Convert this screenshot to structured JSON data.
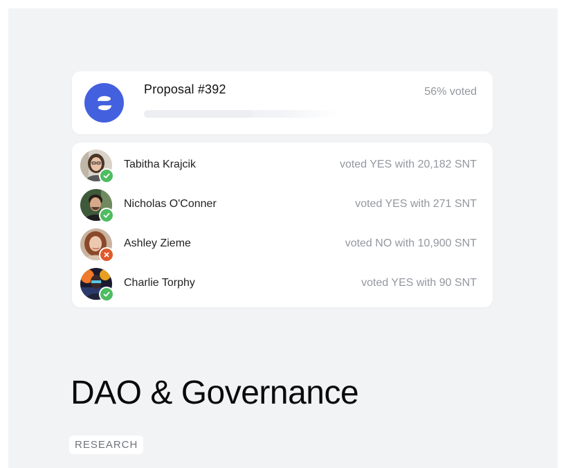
{
  "proposal": {
    "title": "Proposal #392",
    "voted_label": "56% voted",
    "voted_fraction": 0.56,
    "logo_color": "#4360df"
  },
  "votes": [
    {
      "name": "Tabitha Krajcik",
      "detail": "voted YES with 20,182 SNT",
      "vote": "yes"
    },
    {
      "name": "Nicholas O'Conner",
      "detail": "voted YES with 271 SNT",
      "vote": "yes"
    },
    {
      "name": "Ashley Zieme",
      "detail": "voted NO with 10,900 SNT",
      "vote": "no"
    },
    {
      "name": "Charlie Torphy",
      "detail": "voted YES with 90 SNT",
      "vote": "yes"
    }
  ],
  "colors": {
    "yes": "#4ebc60",
    "no": "#e05a2c",
    "background": "#f2f3f5"
  },
  "heading": "DAO & Governance",
  "tag": "RESEARCH"
}
